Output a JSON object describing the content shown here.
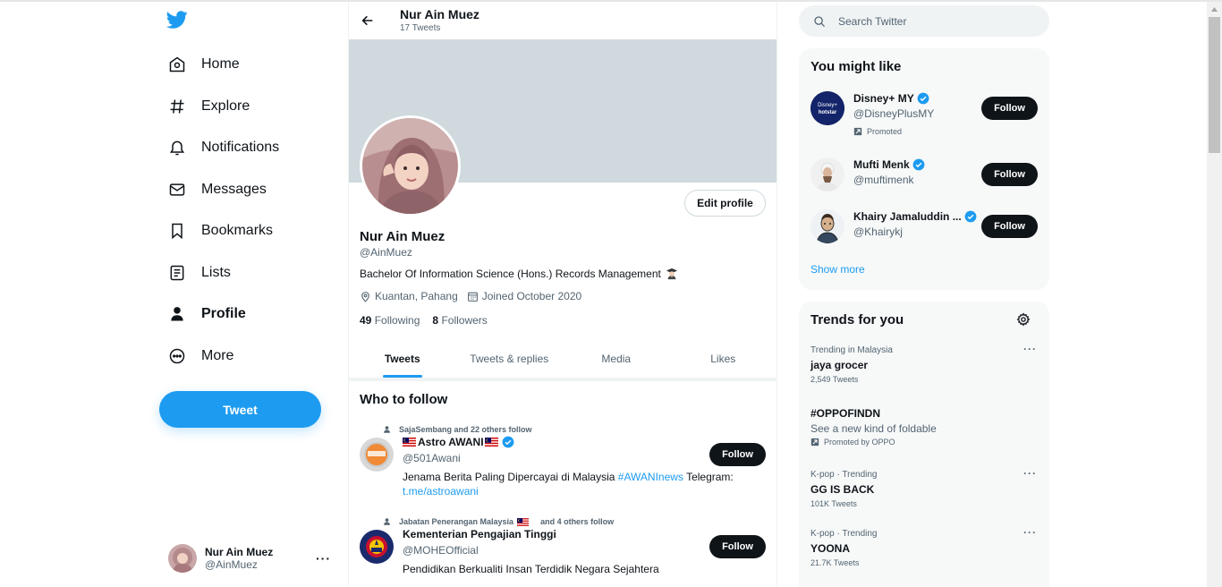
{
  "colors": {
    "accent": "#1d9bf0",
    "text": "#0f1419",
    "muted": "#536471",
    "card": "#f7f9f9",
    "banner": "#cfd9de"
  },
  "nav": {
    "items": [
      {
        "label": "Home",
        "icon": "home-icon"
      },
      {
        "label": "Explore",
        "icon": "hashtag-icon"
      },
      {
        "label": "Notifications",
        "icon": "bell-icon"
      },
      {
        "label": "Messages",
        "icon": "envelope-icon"
      },
      {
        "label": "Bookmarks",
        "icon": "bookmark-icon"
      },
      {
        "label": "Lists",
        "icon": "list-icon"
      },
      {
        "label": "Profile",
        "icon": "person-icon"
      },
      {
        "label": "More",
        "icon": "more-circle-icon"
      }
    ],
    "tweet_button": "Tweet",
    "account": {
      "name": "Nur Ain Muez",
      "handle": "@AinMuez"
    }
  },
  "header": {
    "title": "Nur Ain Muez",
    "subtitle": "17 Tweets"
  },
  "profile": {
    "edit_button": "Edit profile",
    "name": "Nur Ain Muez",
    "handle": "@AinMuez",
    "bio": "Bachelor Of Information Science (Hons.) Records Management",
    "bio_emoji_icon": "graduate-icon",
    "location": "Kuantan, Pahang",
    "joined": "Joined October 2020",
    "following_count": "49",
    "following_label": "Following",
    "followers_count": "8",
    "followers_label": "Followers"
  },
  "tabs": [
    "Tweets",
    "Tweets & replies",
    "Media",
    "Likes"
  ],
  "who_to_follow": {
    "title": "Who to follow",
    "items": [
      {
        "context": "SajaSembang and 22 others follow",
        "name": "Astro AWANI",
        "flag_icon": "malaysia-flag-icon",
        "handle": "@501Awani",
        "bio_text": "Jenama Berita Paling Dipercayai di Malaysia",
        "bio_hashtag": "#AWANInews",
        "bio_after": "Telegram:",
        "bio_link": "t.me/astroawani",
        "button": "Follow"
      },
      {
        "context_name": "Jabatan Penerangan Malaysia",
        "context_rest": "and 4 others follow",
        "name": "Kementerian Pengajian Tinggi",
        "handle": "@MOHEOfficial",
        "bio_text": "Pendidikan Berkualiti Insan Terdidik Negara Sejahtera",
        "button": "Follow"
      }
    ]
  },
  "search": {
    "placeholder": "Search Twitter"
  },
  "you_might_like": {
    "title": "You might like",
    "items": [
      {
        "name": "Disney+ MY",
        "handle": "@DisneyPlusMY",
        "promoted": "Promoted",
        "button": "Follow"
      },
      {
        "name": "Mufti Menk",
        "handle": "@muftimenk",
        "button": "Follow"
      },
      {
        "name": "Khairy Jamaluddin ...",
        "handle": "@Khairykj",
        "button": "Follow"
      }
    ],
    "show_more": "Show more"
  },
  "trends": {
    "title": "Trends for you",
    "items": [
      {
        "context": "Trending in Malaysia",
        "name": "jaya grocer",
        "count": "2,549 Tweets"
      },
      {
        "name": "#OPPOFINDN",
        "description": "See a new kind of foldable",
        "promoted": "Promoted by OPPO"
      },
      {
        "context": "K-pop · Trending",
        "name": "GG IS BACK",
        "count": "101K Tweets"
      },
      {
        "context": "K-pop · Trending",
        "name": "YOONA",
        "count": "21.7K Tweets"
      }
    ]
  }
}
